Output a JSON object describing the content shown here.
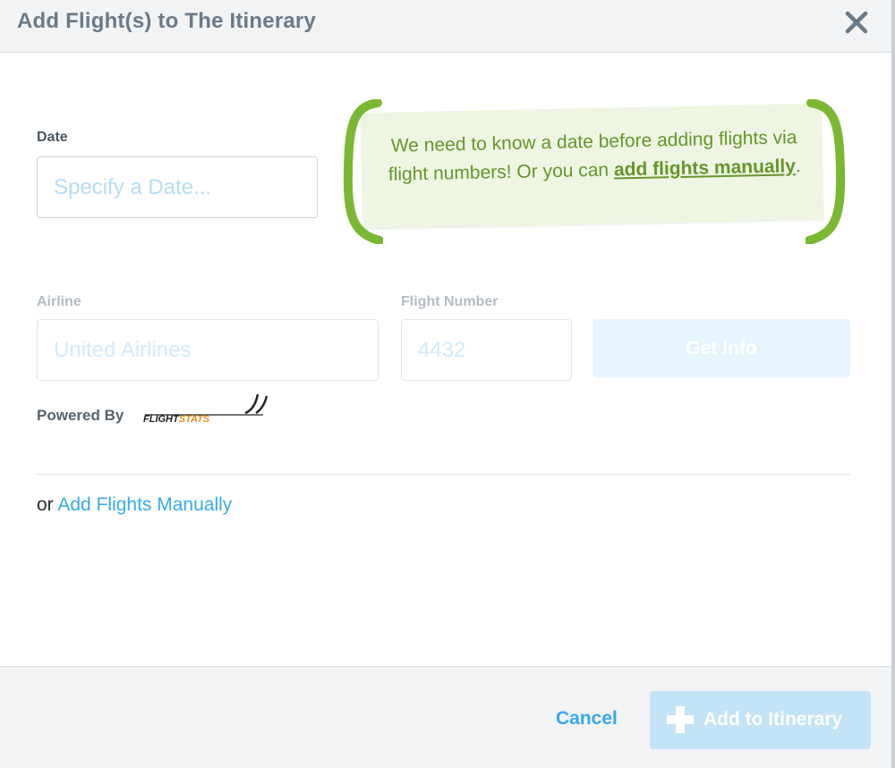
{
  "modal": {
    "title": "Add Flight(s) to The Itinerary",
    "close_icon": "close-icon"
  },
  "form": {
    "date_label": "Date",
    "date_placeholder": "Specify a Date...",
    "airline_label": "Airline",
    "airline_placeholder": "United Airlines",
    "flight_number_label": "Flight Number",
    "flight_number_placeholder": "4432",
    "get_info_label": "Get Info",
    "powered_by_label": "Powered By",
    "powered_by_logo": "FLIGHTSTATS"
  },
  "hint": {
    "text_before": "We need to know a date before adding flights via flight numbers! Or you can ",
    "link_text": "add flights manually",
    "text_after": "."
  },
  "manual": {
    "prefix": "or",
    "link_text": "Add Flights Manually"
  },
  "footer": {
    "cancel_label": "Cancel",
    "add_label": "Add to Itinerary",
    "add_icon": "plus-icon"
  },
  "colors": {
    "accent": "#36acea",
    "hint_green": "#66962c",
    "bracket_green": "#7ab834",
    "disabled_button": "#c4e3f6"
  }
}
